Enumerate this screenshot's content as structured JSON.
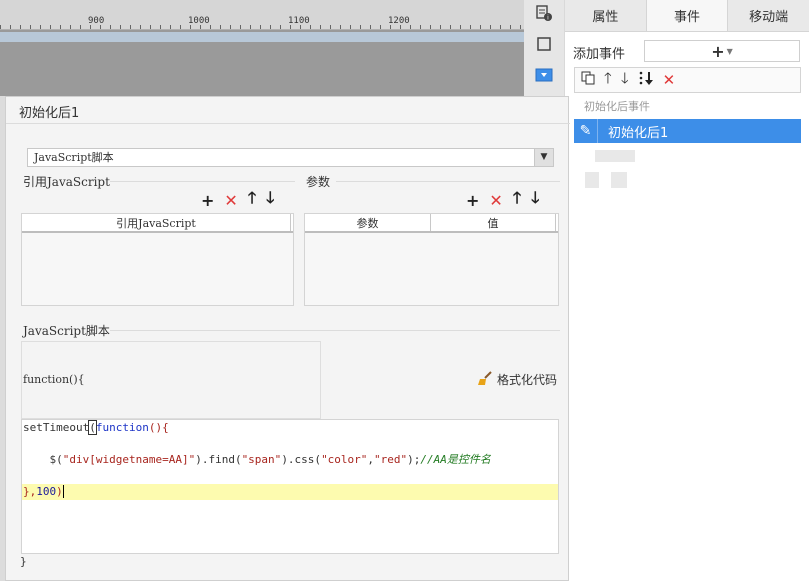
{
  "ruler": {
    "labels": [
      "900",
      "1000",
      "1100",
      "1200"
    ]
  },
  "right_panel": {
    "tabs": [
      {
        "label": "属性"
      },
      {
        "label": "事件"
      },
      {
        "label": "移动端"
      }
    ],
    "add_event_label": "添加事件",
    "add_button_symbol": "+",
    "toolbar_icons": [
      "copy-icon",
      "arrow-up-icon",
      "arrow-down-icon",
      "move-bottom-icon",
      "delete-icon"
    ],
    "event_group_label": "初始化后事件",
    "selected_event": "初始化后1"
  },
  "dialog": {
    "title": "初始化后1",
    "script_type": "JavaScript脚本",
    "ref_section_label": "引用JavaScript",
    "ref_grid_header": "引用JavaScript",
    "param_section_label": "参数",
    "param_headers": [
      "参数",
      "值"
    ],
    "script_section_label": "JavaScript脚本",
    "fn_header": "function(){",
    "format_button_label": "格式化代码",
    "code_lines": [
      "setTimeout(function(){",
      "",
      "    $(\"div[widgetname=AA]\").find(\"span\").css(\"color\",\"red\");//AA是控件名",
      "",
      "},100)"
    ],
    "fn_footer": "}"
  },
  "colors": {
    "accent": "#3d8ee8",
    "delete": "#e03a3a",
    "highlight_line": "#fdfbaf"
  }
}
